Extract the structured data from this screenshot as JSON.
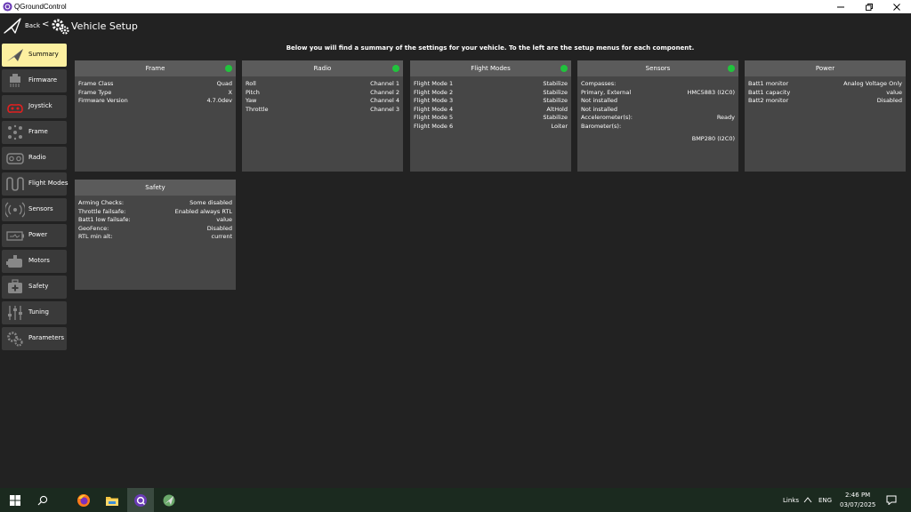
{
  "window": {
    "title": "QGroundControl"
  },
  "toolbar": {
    "back_label": "Back",
    "separator": "<",
    "page_title": "Vehicle Setup"
  },
  "sidebar": {
    "items": [
      {
        "label": "Summary",
        "icon": "paper-plane-icon",
        "active": true
      },
      {
        "label": "Firmware",
        "icon": "firmware-icon",
        "active": false
      },
      {
        "label": "Joystick",
        "icon": "joystick-icon",
        "active": false
      },
      {
        "label": "Frame",
        "icon": "frame-icon",
        "active": false
      },
      {
        "label": "Radio",
        "icon": "radio-icon",
        "active": false
      },
      {
        "label": "Flight Modes",
        "icon": "flight-modes-icon",
        "active": false
      },
      {
        "label": "Sensors",
        "icon": "sensors-icon",
        "active": false
      },
      {
        "label": "Power",
        "icon": "power-icon",
        "active": false
      },
      {
        "label": "Motors",
        "icon": "motors-icon",
        "active": false
      },
      {
        "label": "Safety",
        "icon": "safety-icon",
        "active": false
      },
      {
        "label": "Tuning",
        "icon": "tuning-icon",
        "active": false
      },
      {
        "label": "Parameters",
        "icon": "parameters-icon",
        "active": false
      }
    ]
  },
  "intro": "Below you will find a summary of the settings for your vehicle. To the left are the setup menus for each component.",
  "cards": {
    "frame": {
      "title": "Frame",
      "status": true,
      "rows": [
        {
          "label": "Frame Class",
          "value": "Quad"
        },
        {
          "label": "Frame Type",
          "value": "X"
        },
        {
          "label": "Firmware Version",
          "value": "4.7.0dev"
        }
      ]
    },
    "radio": {
      "title": "Radio",
      "status": true,
      "rows": [
        {
          "label": "Roll",
          "value": "Channel 1"
        },
        {
          "label": "Pitch",
          "value": "Channel 2"
        },
        {
          "label": "Yaw",
          "value": "Channel 4"
        },
        {
          "label": "Throttle",
          "value": "Channel 3"
        }
      ]
    },
    "flight_modes": {
      "title": "Flight Modes",
      "status": true,
      "rows": [
        {
          "label": "Flight Mode 1",
          "value": "Stabilize"
        },
        {
          "label": "Flight Mode 2",
          "value": "Stabilize"
        },
        {
          "label": "Flight Mode 3",
          "value": "Stabilize"
        },
        {
          "label": "Flight Mode 4",
          "value": "AltHold"
        },
        {
          "label": "Flight Mode 5",
          "value": "Stabilize"
        },
        {
          "label": "Flight Mode 6",
          "value": "Loiter"
        }
      ]
    },
    "sensors": {
      "title": "Sensors",
      "status": true,
      "rows": [
        {
          "label": "Compasses:",
          "value": ""
        },
        {
          "label": "Primary, External",
          "value": "HMC5883 (I2C0)"
        },
        {
          "label": "Not installed",
          "value": ""
        },
        {
          "label": "Not installed",
          "value": ""
        },
        {
          "label": "Accelerometer(s):",
          "value": "Ready"
        },
        {
          "label": "Barometer(s):",
          "value": ""
        },
        {
          "label": "",
          "value": "BMP280 (I2C0)"
        }
      ]
    },
    "power": {
      "title": "Power",
      "status": false,
      "rows": [
        {
          "label": "Batt1 monitor",
          "value": "Analog Voltage Only"
        },
        {
          "label": "Batt1 capacity",
          "value": "value"
        },
        {
          "label": "Batt2 monitor",
          "value": "Disabled"
        }
      ]
    },
    "safety": {
      "title": "Safety",
      "status": false,
      "rows": [
        {
          "label": "Arming Checks:",
          "value": "Some disabled"
        },
        {
          "label": "Throttle failsafe:",
          "value": "Enabled always RTL"
        },
        {
          "label": "Batt1 low failsafe:",
          "value": "value"
        },
        {
          "label": "GeoFence:",
          "value": "Disabled"
        },
        {
          "label": "RTL min alt:",
          "value": "current"
        }
      ]
    }
  },
  "taskbar": {
    "links_label": "Links",
    "lang": "ENG",
    "time": "2:46 PM",
    "date": "03/07/2025"
  },
  "colors": {
    "accent_active": "#fdf0a0",
    "status_ok": "#21c33d",
    "panel": "#464646",
    "panel_header": "#5b5b5b",
    "background": "#222222"
  }
}
